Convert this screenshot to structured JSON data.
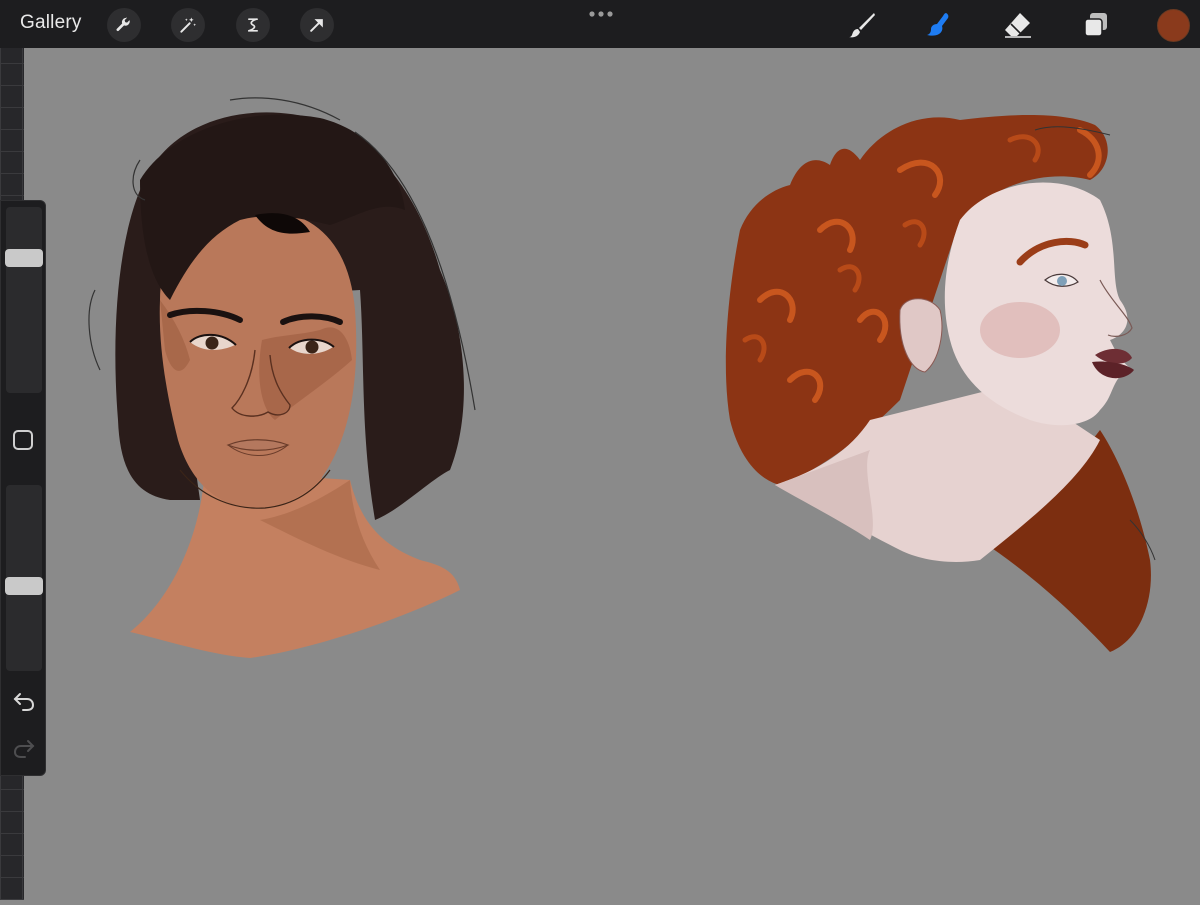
{
  "topbar": {
    "gallery_label": "Gallery",
    "left_tools": [
      "wrench-icon",
      "magic-wand-icon",
      "selection-icon",
      "transform-arrow-icon"
    ],
    "more_menu": "ellipsis-icon",
    "right_tools": [
      "brush-icon",
      "smudge-icon",
      "eraser-icon",
      "layers-icon"
    ],
    "active_tool": "smudge-icon",
    "current_color": "#8a3a1c",
    "accent_color": "#1e7cf2"
  },
  "sidebar": {
    "brush_size_level": 0.75,
    "opacity_level": 0.45,
    "modify_button": "square-icon",
    "undo": "undo-icon",
    "redo": "redo-icon"
  },
  "canvas": {
    "background_color": "#8a8a8a",
    "drawings": [
      "dark-haired-portrait",
      "red-haired-portrait"
    ]
  }
}
